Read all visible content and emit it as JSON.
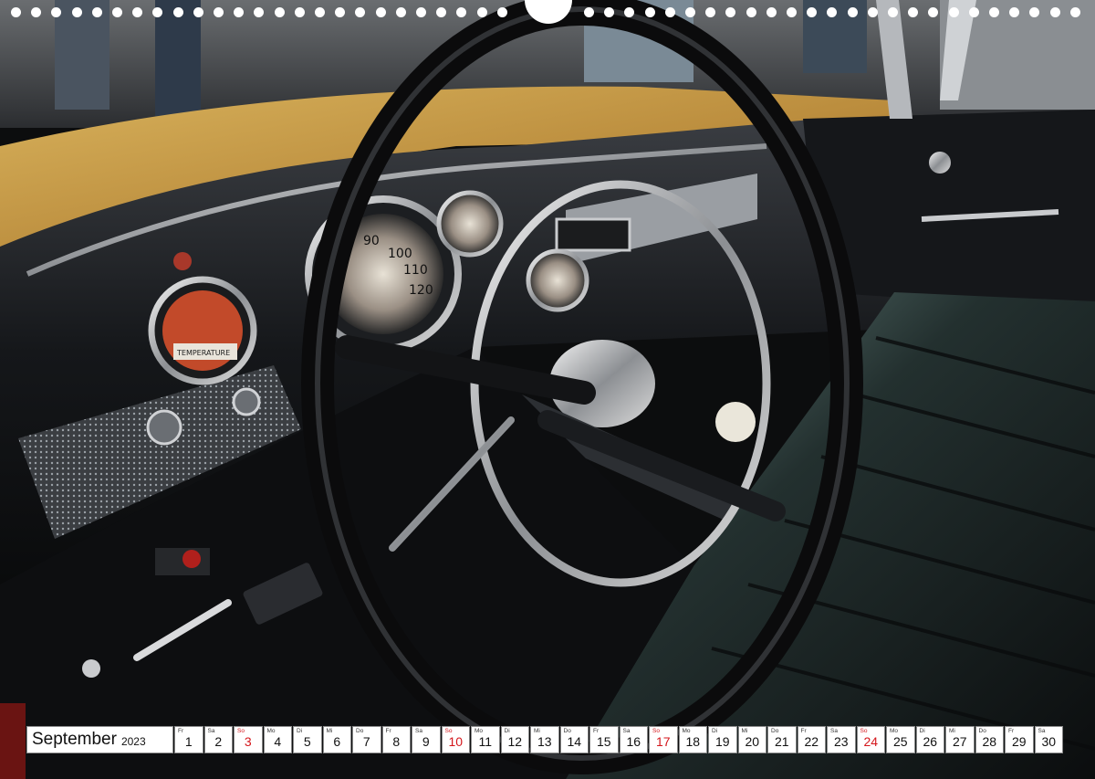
{
  "calendar": {
    "month": "September",
    "year": "2023",
    "days": [
      {
        "wd": "Fr",
        "n": "1",
        "sunday": false
      },
      {
        "wd": "Sa",
        "n": "2",
        "sunday": false
      },
      {
        "wd": "So",
        "n": "3",
        "sunday": true
      },
      {
        "wd": "Mo",
        "n": "4",
        "sunday": false
      },
      {
        "wd": "Di",
        "n": "5",
        "sunday": false
      },
      {
        "wd": "Mi",
        "n": "6",
        "sunday": false
      },
      {
        "wd": "Do",
        "n": "7",
        "sunday": false
      },
      {
        "wd": "Fr",
        "n": "8",
        "sunday": false
      },
      {
        "wd": "Sa",
        "n": "9",
        "sunday": false
      },
      {
        "wd": "So",
        "n": "10",
        "sunday": true
      },
      {
        "wd": "Mo",
        "n": "11",
        "sunday": false
      },
      {
        "wd": "Di",
        "n": "12",
        "sunday": false
      },
      {
        "wd": "Mi",
        "n": "13",
        "sunday": false
      },
      {
        "wd": "Do",
        "n": "14",
        "sunday": false
      },
      {
        "wd": "Fr",
        "n": "15",
        "sunday": false
      },
      {
        "wd": "Sa",
        "n": "16",
        "sunday": false
      },
      {
        "wd": "So",
        "n": "17",
        "sunday": true
      },
      {
        "wd": "Mo",
        "n": "18",
        "sunday": false
      },
      {
        "wd": "Di",
        "n": "19",
        "sunday": false
      },
      {
        "wd": "Mi",
        "n": "20",
        "sunday": false
      },
      {
        "wd": "Do",
        "n": "21",
        "sunday": false
      },
      {
        "wd": "Fr",
        "n": "22",
        "sunday": false
      },
      {
        "wd": "Sa",
        "n": "23",
        "sunday": false
      },
      {
        "wd": "So",
        "n": "24",
        "sunday": true
      },
      {
        "wd": "Mo",
        "n": "25",
        "sunday": false
      },
      {
        "wd": "Di",
        "n": "26",
        "sunday": false
      },
      {
        "wd": "Mi",
        "n": "27",
        "sunday": false
      },
      {
        "wd": "Do",
        "n": "28",
        "sunday": false
      },
      {
        "wd": "Fr",
        "n": "29",
        "sunday": false
      },
      {
        "wd": "Sa",
        "n": "30",
        "sunday": false
      }
    ]
  },
  "photo": {
    "subject": "classic-car-interior-steering-wheel",
    "speedometer_ticks": [
      "90",
      "100",
      "110",
      "120"
    ],
    "gauge_label": "TEMPERATURE"
  },
  "colors": {
    "sunday": "#d4161b",
    "cell_border": "#8a8a8a",
    "paint": "#c8a04a"
  }
}
